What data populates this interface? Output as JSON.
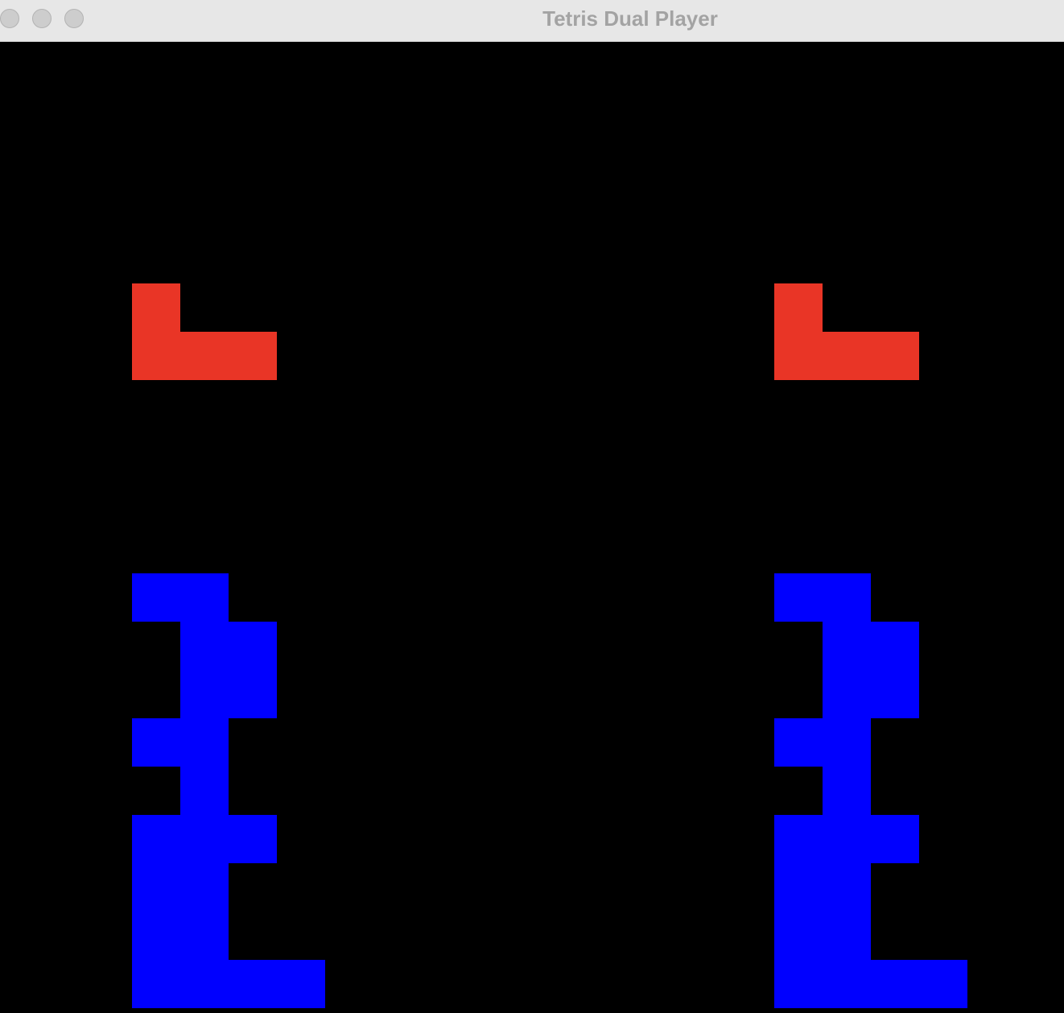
{
  "window": {
    "title": "Tetris Dual Player"
  },
  "colors": {
    "background": "#000000",
    "falling_piece": "#e93526",
    "stack": "#0000ff",
    "titlebar": "#e7e7e7",
    "title_text": "#a3a3a3"
  },
  "boards": [
    {
      "id": "player-1",
      "falling_piece": {
        "shape": "J",
        "cells": [
          [
            0,
            5
          ],
          [
            0,
            6
          ],
          [
            1,
            6
          ],
          [
            2,
            6
          ]
        ]
      },
      "stack": [
        [
          0,
          11
        ],
        [
          1,
          11
        ],
        [
          1,
          12
        ],
        [
          2,
          12
        ],
        [
          1,
          13
        ],
        [
          2,
          13
        ],
        [
          0,
          14
        ],
        [
          1,
          14
        ],
        [
          1,
          15
        ],
        [
          0,
          16
        ],
        [
          1,
          16
        ],
        [
          2,
          16
        ],
        [
          0,
          17
        ],
        [
          1,
          17
        ],
        [
          0,
          18
        ],
        [
          1,
          18
        ],
        [
          0,
          19
        ],
        [
          1,
          19
        ],
        [
          2,
          19
        ],
        [
          3,
          19
        ]
      ]
    },
    {
      "id": "player-2",
      "falling_piece": {
        "shape": "J",
        "cells": [
          [
            0,
            5
          ],
          [
            0,
            6
          ],
          [
            1,
            6
          ],
          [
            2,
            6
          ]
        ]
      },
      "stack": [
        [
          0,
          11
        ],
        [
          1,
          11
        ],
        [
          1,
          12
        ],
        [
          2,
          12
        ],
        [
          1,
          13
        ],
        [
          2,
          13
        ],
        [
          0,
          14
        ],
        [
          1,
          14
        ],
        [
          1,
          15
        ],
        [
          0,
          16
        ],
        [
          1,
          16
        ],
        [
          2,
          16
        ],
        [
          0,
          17
        ],
        [
          1,
          17
        ],
        [
          0,
          18
        ],
        [
          1,
          18
        ],
        [
          0,
          19
        ],
        [
          1,
          19
        ],
        [
          2,
          19
        ],
        [
          3,
          19
        ]
      ]
    }
  ]
}
